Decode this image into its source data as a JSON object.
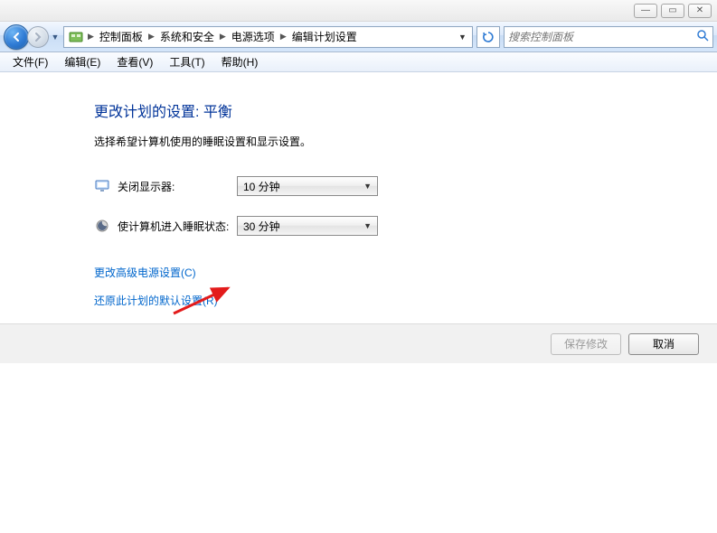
{
  "titlebar": {
    "min_symbol": "—",
    "max_symbol": "▭",
    "close_symbol": "✕"
  },
  "breadcrumb": {
    "items": [
      "控制面板",
      "系统和安全",
      "电源选项",
      "编辑计划设置"
    ]
  },
  "search": {
    "placeholder": "搜索控制面板"
  },
  "menu": {
    "items": [
      "文件(F)",
      "编辑(E)",
      "查看(V)",
      "工具(T)",
      "帮助(H)"
    ]
  },
  "page": {
    "heading": "更改计划的设置: 平衡",
    "subtext": "选择希望计算机使用的睡眠设置和显示设置。"
  },
  "settings": {
    "display_off": {
      "label": "关闭显示器:",
      "value": "10 分钟"
    },
    "sleep": {
      "label": "使计算机进入睡眠状态:",
      "value": "30 分钟"
    }
  },
  "links": {
    "advanced": "更改高级电源设置(C)",
    "restore": "还原此计划的默认设置(R)"
  },
  "footer": {
    "save": "保存修改",
    "cancel": "取消"
  }
}
